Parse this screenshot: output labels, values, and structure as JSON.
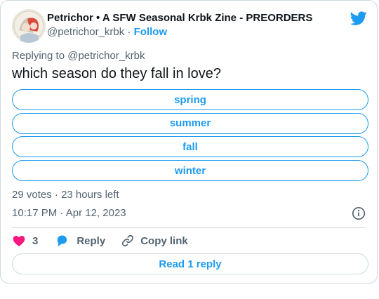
{
  "author": {
    "name": "Petrichor • A SFW Seasonal Krbk Zine - PREORDERS",
    "handle": "@petrichor_krbk",
    "separator": "·",
    "follow_label": "Follow"
  },
  "replying_to": {
    "prefix": "Replying to",
    "handle": "@petrichor_krbk"
  },
  "tweet": {
    "text": "which season do they fall in love?"
  },
  "poll": {
    "options": [
      "spring",
      "summer",
      "fall",
      "winter"
    ],
    "votes": "29 votes",
    "separator": "·",
    "time_left": "23 hours left"
  },
  "timestamp": {
    "time": "10:17 PM",
    "separator": "·",
    "date": "Apr 12, 2023"
  },
  "actions": {
    "like_count": "3",
    "reply_label": "Reply",
    "copy_label": "Copy link"
  },
  "read_replies_label": "Read 1 reply",
  "colors": {
    "accent": "#1d9bf0",
    "like": "#f91880",
    "text": "#0f1419",
    "secondary": "#536471",
    "border": "#cfd9de"
  },
  "icons": [
    "avatar",
    "twitter-bird-icon",
    "info-icon",
    "heart-icon",
    "reply-bubble-icon",
    "link-icon"
  ]
}
